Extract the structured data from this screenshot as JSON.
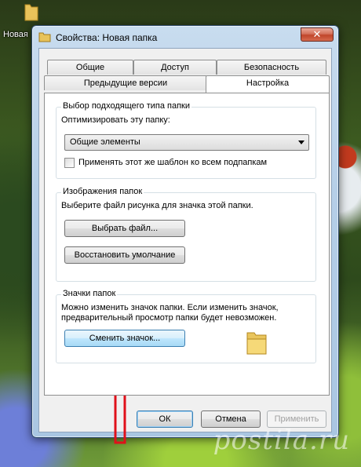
{
  "desktop": {
    "icon_label": "Новая"
  },
  "window": {
    "title": "Свойства: Новая папка",
    "close_glyph": "✕"
  },
  "tabs": {
    "row1": [
      "Общие",
      "Доступ",
      "Безопасность"
    ],
    "row2": [
      "Предыдущие версии",
      "Настройка"
    ],
    "active": "Настройка"
  },
  "folder_type": {
    "group_title": "Выбор подходящего типа папки",
    "optimize_label": "Оптимизировать эту папку:",
    "selected_value": "Общие элементы",
    "apply_checkbox_label": "Применять этот же шаблон ко всем подпапкам",
    "apply_checked": false
  },
  "folder_pictures": {
    "group_title": "Изображения папок",
    "description": "Выберите файл рисунка для значка этой папки.",
    "choose_file_button": "Выбрать файл...",
    "restore_default_button": "Восстановить умолчание"
  },
  "folder_icons": {
    "group_title": "Значки папок",
    "description_line1": "Можно изменить значок папки. Если изменить значок,",
    "description_line2": "предварительный просмотр папки будет невозможен.",
    "change_icon_button": "Сменить значок...",
    "icon": "folder-icon"
  },
  "footer_buttons": {
    "ok": "ОК",
    "cancel": "Отмена",
    "apply": "Применить"
  },
  "watermark": "postila.ru",
  "colors": {
    "annotation_arrow": "#e0101a",
    "close_button": "#c0452a"
  }
}
